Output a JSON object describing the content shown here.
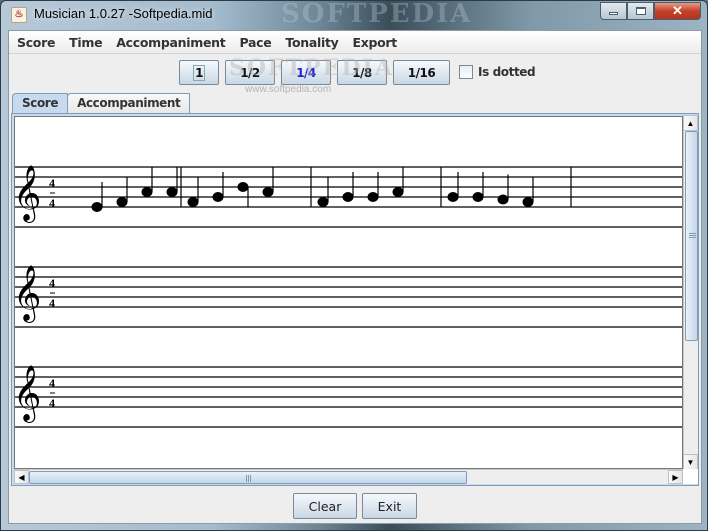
{
  "window": {
    "title": "Musician 1.0.27 -Softpedia.mid",
    "watermark": "SOFTPEDIA",
    "controls": {
      "minimize": "minimize-icon",
      "maximize": "maximize-icon",
      "close": "close-icon",
      "close_glyph": "✕"
    }
  },
  "menubar": {
    "items": [
      {
        "label": "Score"
      },
      {
        "label": "Time"
      },
      {
        "label": "Accompaniment"
      },
      {
        "label": "Pace"
      },
      {
        "label": "Tonality"
      },
      {
        "label": "Export"
      }
    ]
  },
  "toolbar": {
    "durations": [
      {
        "label": "1",
        "focused": true,
        "selected": false
      },
      {
        "label": "1/2",
        "focused": false,
        "selected": false
      },
      {
        "label": "1/4",
        "focused": false,
        "selected": true
      },
      {
        "label": "1/8",
        "focused": false,
        "selected": false
      },
      {
        "label": "1/16",
        "focused": false,
        "selected": false
      }
    ],
    "dotted": {
      "label": "Is dotted",
      "checked": false
    },
    "watermark_text": "SOFTPEDIA",
    "watermark_url": "www.softpedia.com"
  },
  "tabs": [
    {
      "label": "Score",
      "active": true
    },
    {
      "label": "Accompaniment",
      "active": false
    }
  ],
  "score": {
    "clef": "treble",
    "time_signature": {
      "numerator": "4",
      "denominator": "4"
    },
    "staves": [
      {
        "measures": [
          {
            "notes": [
              {
                "step": -2,
                "stem": "up"
              },
              {
                "step": -1,
                "stem": "up"
              },
              {
                "step": 1,
                "stem": "up"
              },
              {
                "step": 1,
                "stem": "up"
              }
            ]
          },
          {
            "notes": [
              {
                "step": -1,
                "stem": "up"
              },
              {
                "step": 0,
                "stem": "up"
              },
              {
                "step": 2,
                "stem": "down"
              },
              {
                "step": 1,
                "stem": "up"
              }
            ]
          },
          {
            "notes": [
              {
                "step": -1,
                "stem": "up"
              },
              {
                "step": 0,
                "stem": "up"
              },
              {
                "step": 0,
                "stem": "up"
              },
              {
                "step": 1,
                "stem": "up"
              }
            ]
          },
          {
            "notes": [
              {
                "step": 0,
                "stem": "up"
              },
              {
                "step": 0,
                "stem": "up"
              },
              {
                "step": -0.5,
                "stem": "up"
              },
              {
                "step": -1,
                "stem": "up"
              }
            ]
          }
        ]
      },
      {
        "measures": []
      },
      {
        "measures": []
      }
    ]
  },
  "scrollbars": {
    "vertical": {
      "position_fraction": 0.0,
      "visible_fraction": 0.63,
      "up": "▲",
      "down": "▼"
    },
    "horizontal": {
      "position_fraction": 0.0,
      "visible_fraction": 0.68,
      "left": "◀",
      "right": "▶"
    }
  },
  "buttons": {
    "clear": "Clear",
    "exit": "Exit"
  }
}
